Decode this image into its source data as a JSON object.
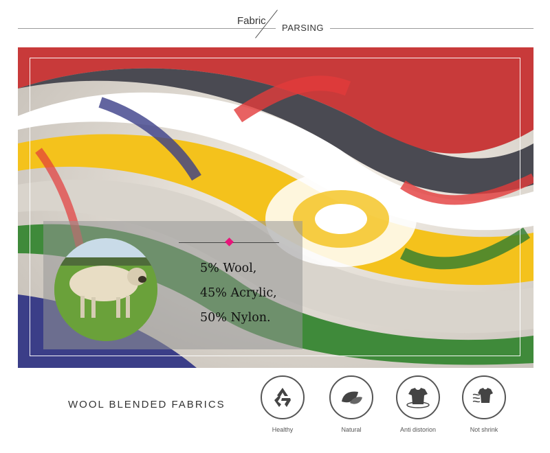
{
  "header": {
    "word1": "Fabric",
    "word2": "PARSING"
  },
  "composition": {
    "line1": "5% Wool,",
    "line2": "45% Acrylic,",
    "line3": "50% Nylon."
  },
  "accent_color": "#e8157a",
  "bottom": {
    "title": "WOOL BLENDED FABRICS",
    "features": [
      {
        "icon": "recycle-icon",
        "label": "Healthy"
      },
      {
        "icon": "leaf-icon",
        "label": "Natural"
      },
      {
        "icon": "tshirt-icon",
        "label": "Anti distorion"
      },
      {
        "icon": "tshirt-wash-icon",
        "label": "Not shrink"
      }
    ]
  }
}
